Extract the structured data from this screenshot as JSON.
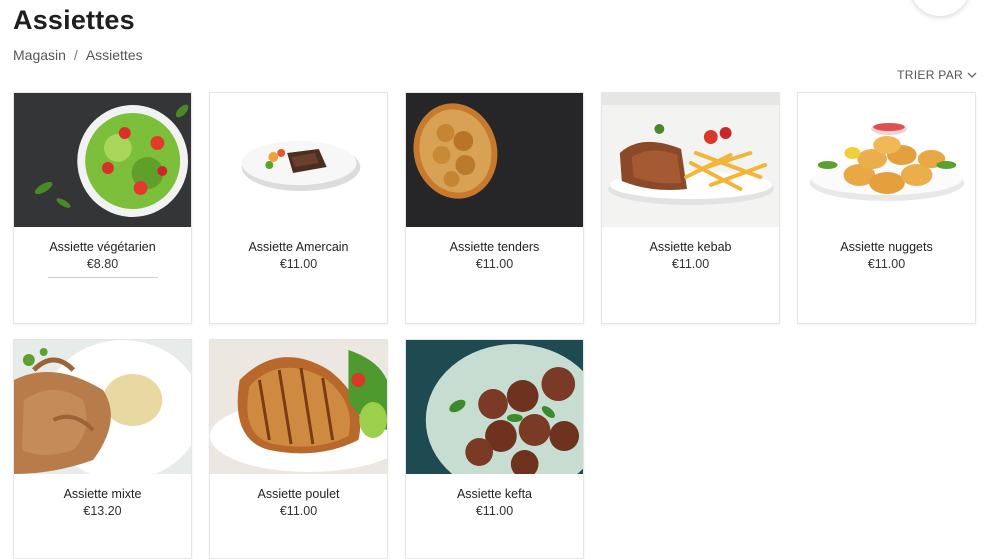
{
  "page": {
    "title": "Assiettes"
  },
  "breadcrumb": {
    "items": [
      "Magasin",
      "Assiettes"
    ],
    "separator": "/"
  },
  "sort": {
    "label": "TRIER PAR"
  },
  "products": [
    {
      "name": "Assiette végétarien",
      "price": "€8.80",
      "image": "salad-bowl"
    },
    {
      "name": "Assiette Amercain",
      "price": "€11.00",
      "image": "steak-plate"
    },
    {
      "name": "Assiette tenders",
      "price": "€11.00",
      "image": "chicken-tenders"
    },
    {
      "name": "Assiette kebab",
      "price": "€11.00",
      "image": "kebab-fries"
    },
    {
      "name": "Assiette nuggets",
      "price": "€11.00",
      "image": "chicken-nuggets"
    },
    {
      "name": "Assiette mixte",
      "price": "€13.20",
      "image": "shredded-meat"
    },
    {
      "name": "Assiette poulet",
      "price": "€11.00",
      "image": "grilled-chicken"
    },
    {
      "name": "Assiette kefta",
      "price": "€11.00",
      "image": "meatballs"
    }
  ]
}
